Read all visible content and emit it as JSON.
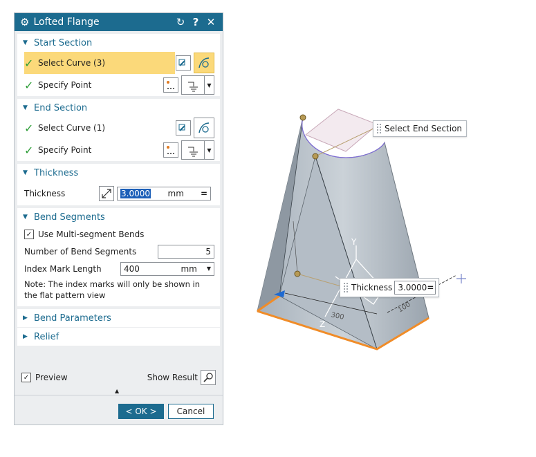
{
  "dialog": {
    "title": "Lofted Flange",
    "start_section": {
      "header": "Start Section",
      "select_curve": "Select Curve (3)",
      "specify_point": "Specify Point"
    },
    "end_section": {
      "header": "End Section",
      "select_curve": "Select Curve (1)",
      "specify_point": "Specify Point"
    },
    "thickness": {
      "header": "Thickness",
      "label": "Thickness",
      "value": "3.0000",
      "unit": "mm"
    },
    "bend_segments": {
      "header": "Bend Segments",
      "use_multi_label": "Use Multi-segment Bends",
      "use_multi_checked": true,
      "num_label": "Number of Bend Segments",
      "num_value": "5",
      "index_label": "Index Mark Length",
      "index_value": "400",
      "index_unit": "mm",
      "note": "Note: The index marks will only be shown in the flat pattern view"
    },
    "bend_parameters": {
      "header": "Bend Parameters"
    },
    "relief": {
      "header": "Relief"
    },
    "preview_label": "Preview",
    "preview_checked": true,
    "show_result_label": "Show Result",
    "ok_label": "< OK >",
    "cancel_label": "Cancel"
  },
  "viewport": {
    "tooltip_select_end": "Select End Section",
    "thickness_label": "Thickness",
    "thickness_value": "3.0000",
    "axis_y": "Y",
    "axis_z": "Z",
    "dim_left": "300",
    "dim_right": "100"
  },
  "colors": {
    "accent": "#1c6b8f",
    "highlight": "#fbd97a",
    "check": "#2e9e38",
    "edge_orange": "#f08c28"
  },
  "icons": [
    "gear-icon",
    "reset-icon",
    "help-icon",
    "close-icon",
    "curve-select-icon",
    "point-icon",
    "magnifier-icon"
  ]
}
